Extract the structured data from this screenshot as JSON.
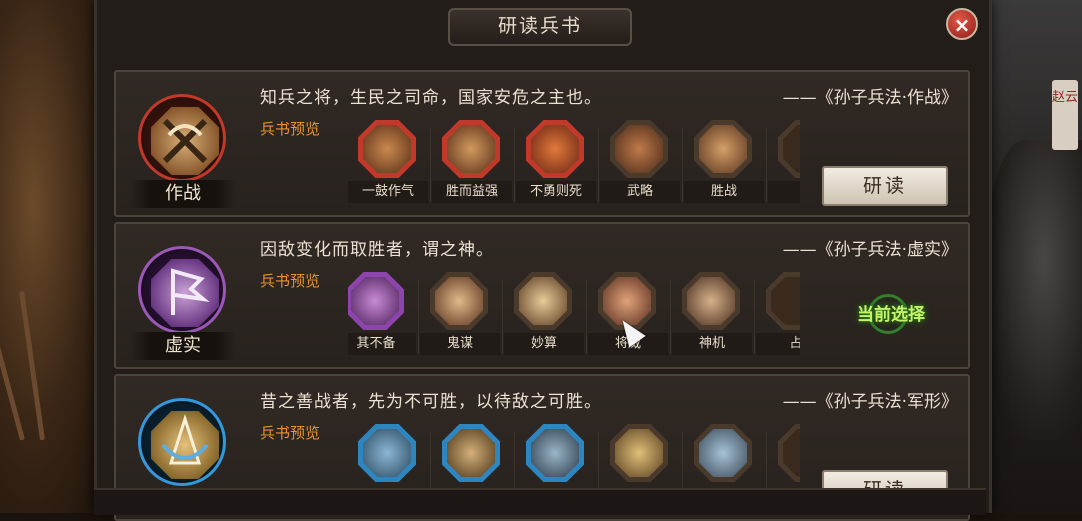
{
  "window": {
    "title": "研读兵书",
    "close_icon": "×"
  },
  "background": {
    "banner_text": "赵云"
  },
  "cards": [
    {
      "badge_label": "作战",
      "badge_color": "#c0392b",
      "quote": "知兵之将，生民之司命，国家安危之主也。",
      "source": "——《孙子兵法·作战》",
      "preview_label": "兵书预览",
      "skills": [
        "一鼓作气",
        "胜而益强",
        "不勇则死",
        "武略",
        "胜战"
      ],
      "action_label": "研读"
    },
    {
      "badge_label": "虚实",
      "badge_color": "#8e44ad",
      "quote": "因敌变化而取胜者，谓之神。",
      "source": "——《孙子兵法·虚实》",
      "preview_label": "兵书预览",
      "skills": [
        "其不备",
        "鬼谋",
        "妙算",
        "将威",
        "神机",
        "占"
      ],
      "status_label": "当前选择"
    },
    {
      "badge_label": "",
      "badge_color": "#2e86c1",
      "quote": "昔之善战者，先为不可胜，以待敌之可胜。",
      "source": "——《孙子兵法·军形》",
      "preview_label": "兵书预览",
      "skills": [
        "",
        "",
        "",
        "",
        ""
      ],
      "action_label": "研读"
    }
  ]
}
